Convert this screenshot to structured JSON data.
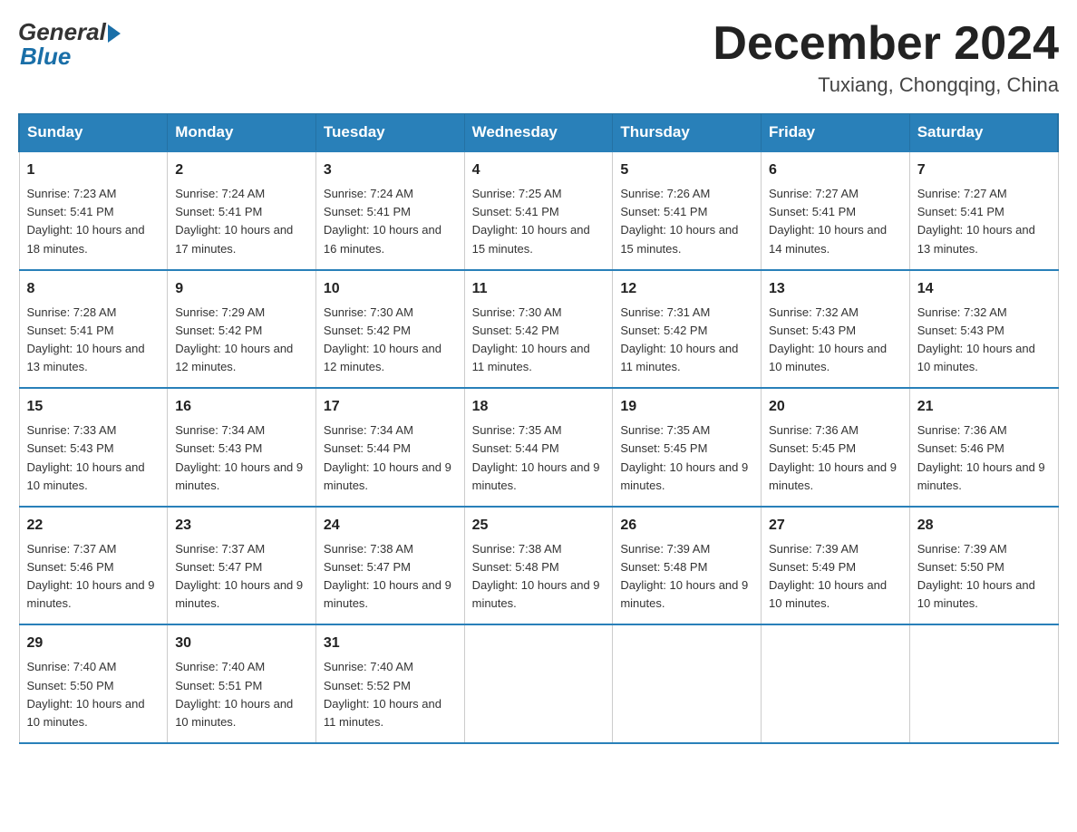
{
  "logo": {
    "general": "General",
    "blue": "Blue"
  },
  "title": "December 2024",
  "location": "Tuxiang, Chongqing, China",
  "days_of_week": [
    "Sunday",
    "Monday",
    "Tuesday",
    "Wednesday",
    "Thursday",
    "Friday",
    "Saturday"
  ],
  "weeks": [
    [
      {
        "day": "1",
        "sunrise": "7:23 AM",
        "sunset": "5:41 PM",
        "daylight": "10 hours and 18 minutes."
      },
      {
        "day": "2",
        "sunrise": "7:24 AM",
        "sunset": "5:41 PM",
        "daylight": "10 hours and 17 minutes."
      },
      {
        "day": "3",
        "sunrise": "7:24 AM",
        "sunset": "5:41 PM",
        "daylight": "10 hours and 16 minutes."
      },
      {
        "day": "4",
        "sunrise": "7:25 AM",
        "sunset": "5:41 PM",
        "daylight": "10 hours and 15 minutes."
      },
      {
        "day": "5",
        "sunrise": "7:26 AM",
        "sunset": "5:41 PM",
        "daylight": "10 hours and 15 minutes."
      },
      {
        "day": "6",
        "sunrise": "7:27 AM",
        "sunset": "5:41 PM",
        "daylight": "10 hours and 14 minutes."
      },
      {
        "day": "7",
        "sunrise": "7:27 AM",
        "sunset": "5:41 PM",
        "daylight": "10 hours and 13 minutes."
      }
    ],
    [
      {
        "day": "8",
        "sunrise": "7:28 AM",
        "sunset": "5:41 PM",
        "daylight": "10 hours and 13 minutes."
      },
      {
        "day": "9",
        "sunrise": "7:29 AM",
        "sunset": "5:42 PM",
        "daylight": "10 hours and 12 minutes."
      },
      {
        "day": "10",
        "sunrise": "7:30 AM",
        "sunset": "5:42 PM",
        "daylight": "10 hours and 12 minutes."
      },
      {
        "day": "11",
        "sunrise": "7:30 AM",
        "sunset": "5:42 PM",
        "daylight": "10 hours and 11 minutes."
      },
      {
        "day": "12",
        "sunrise": "7:31 AM",
        "sunset": "5:42 PM",
        "daylight": "10 hours and 11 minutes."
      },
      {
        "day": "13",
        "sunrise": "7:32 AM",
        "sunset": "5:43 PM",
        "daylight": "10 hours and 10 minutes."
      },
      {
        "day": "14",
        "sunrise": "7:32 AM",
        "sunset": "5:43 PM",
        "daylight": "10 hours and 10 minutes."
      }
    ],
    [
      {
        "day": "15",
        "sunrise": "7:33 AM",
        "sunset": "5:43 PM",
        "daylight": "10 hours and 10 minutes."
      },
      {
        "day": "16",
        "sunrise": "7:34 AM",
        "sunset": "5:43 PM",
        "daylight": "10 hours and 9 minutes."
      },
      {
        "day": "17",
        "sunrise": "7:34 AM",
        "sunset": "5:44 PM",
        "daylight": "10 hours and 9 minutes."
      },
      {
        "day": "18",
        "sunrise": "7:35 AM",
        "sunset": "5:44 PM",
        "daylight": "10 hours and 9 minutes."
      },
      {
        "day": "19",
        "sunrise": "7:35 AM",
        "sunset": "5:45 PM",
        "daylight": "10 hours and 9 minutes."
      },
      {
        "day": "20",
        "sunrise": "7:36 AM",
        "sunset": "5:45 PM",
        "daylight": "10 hours and 9 minutes."
      },
      {
        "day": "21",
        "sunrise": "7:36 AM",
        "sunset": "5:46 PM",
        "daylight": "10 hours and 9 minutes."
      }
    ],
    [
      {
        "day": "22",
        "sunrise": "7:37 AM",
        "sunset": "5:46 PM",
        "daylight": "10 hours and 9 minutes."
      },
      {
        "day": "23",
        "sunrise": "7:37 AM",
        "sunset": "5:47 PM",
        "daylight": "10 hours and 9 minutes."
      },
      {
        "day": "24",
        "sunrise": "7:38 AM",
        "sunset": "5:47 PM",
        "daylight": "10 hours and 9 minutes."
      },
      {
        "day": "25",
        "sunrise": "7:38 AM",
        "sunset": "5:48 PM",
        "daylight": "10 hours and 9 minutes."
      },
      {
        "day": "26",
        "sunrise": "7:39 AM",
        "sunset": "5:48 PM",
        "daylight": "10 hours and 9 minutes."
      },
      {
        "day": "27",
        "sunrise": "7:39 AM",
        "sunset": "5:49 PM",
        "daylight": "10 hours and 10 minutes."
      },
      {
        "day": "28",
        "sunrise": "7:39 AM",
        "sunset": "5:50 PM",
        "daylight": "10 hours and 10 minutes."
      }
    ],
    [
      {
        "day": "29",
        "sunrise": "7:40 AM",
        "sunset": "5:50 PM",
        "daylight": "10 hours and 10 minutes."
      },
      {
        "day": "30",
        "sunrise": "7:40 AM",
        "sunset": "5:51 PM",
        "daylight": "10 hours and 10 minutes."
      },
      {
        "day": "31",
        "sunrise": "7:40 AM",
        "sunset": "5:52 PM",
        "daylight": "10 hours and 11 minutes."
      },
      null,
      null,
      null,
      null
    ]
  ],
  "labels": {
    "sunrise": "Sunrise:",
    "sunset": "Sunset:",
    "daylight": "Daylight:"
  }
}
